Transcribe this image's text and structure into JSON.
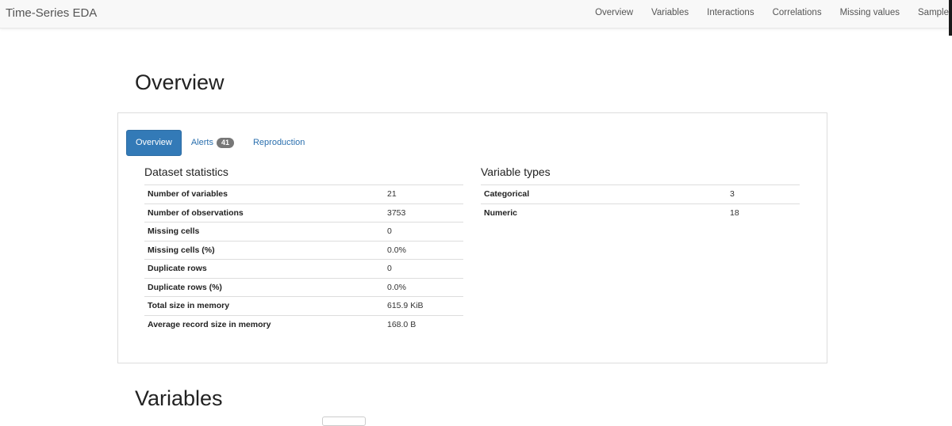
{
  "navbar": {
    "brand": "Time-Series EDA",
    "links": [
      "Overview",
      "Variables",
      "Interactions",
      "Correlations",
      "Missing values",
      "Sample"
    ]
  },
  "overview": {
    "title": "Overview",
    "tabs": {
      "overview": "Overview",
      "alerts": "Alerts",
      "alerts_count": "41",
      "reproduction": "Reproduction"
    },
    "dataset_statistics": {
      "title": "Dataset statistics",
      "rows": [
        {
          "label": "Number of variables",
          "value": "21"
        },
        {
          "label": "Number of observations",
          "value": "3753"
        },
        {
          "label": "Missing cells",
          "value": "0"
        },
        {
          "label": "Missing cells (%)",
          "value": "0.0%"
        },
        {
          "label": "Duplicate rows",
          "value": "0"
        },
        {
          "label": "Duplicate rows (%)",
          "value": "0.0%"
        },
        {
          "label": "Total size in memory",
          "value": "615.9 KiB"
        },
        {
          "label": "Average record size in memory",
          "value": "168.0 B"
        }
      ]
    },
    "variable_types": {
      "title": "Variable types",
      "rows": [
        {
          "label": "Categorical",
          "value": "3"
        },
        {
          "label": "Numeric",
          "value": "18"
        }
      ]
    }
  },
  "variables": {
    "title": "Variables"
  }
}
